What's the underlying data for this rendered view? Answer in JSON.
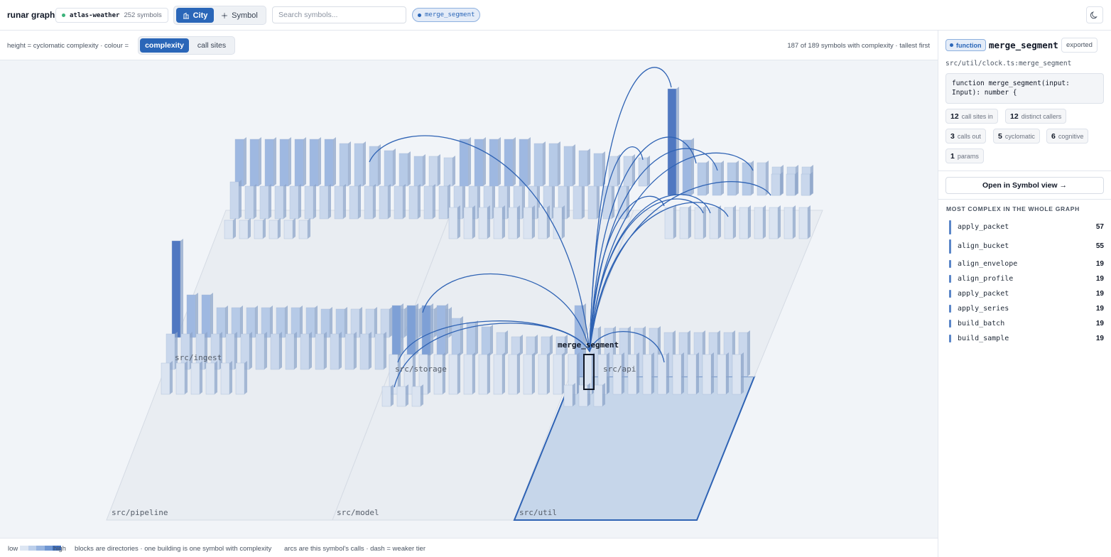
{
  "app": {
    "title": "runar graph"
  },
  "repo": {
    "name": "atlas-weather",
    "count": "252 symbols"
  },
  "view_toggle": {
    "city": "City",
    "symbol": "Symbol",
    "active": "City"
  },
  "search": {
    "placeholder": "Search symbols...",
    "value": ""
  },
  "selection_chip": {
    "label": "merge_segment"
  },
  "canvas_header": {
    "legend": "height = cyclomatic complexity · colour =",
    "modes": [
      "complexity",
      "call sites"
    ],
    "active_mode": "complexity",
    "status": "187 of 189 symbols with complexity · tallest first"
  },
  "city": {
    "directories": [
      "src/pipeline",
      "src/model",
      "src/util",
      "src/ingest",
      "src/storage",
      "src/api"
    ],
    "selected_directory": "src/util",
    "selected_symbol": "merge_segment"
  },
  "footer": {
    "low": "low",
    "high": "high",
    "text1": "blocks are directories · one building is one symbol with complexity",
    "text2": "arcs are this symbol's calls · dash = weaker tier",
    "swatches": [
      "#dde6f3",
      "#bccfeb",
      "#98b5e0",
      "#6f96d2",
      "#3f6fbf"
    ]
  },
  "panel": {
    "kind": "function",
    "name": "merge_segment",
    "exported": "exported",
    "path": "src/util/clock.ts:merge_segment",
    "signature": "function merge_segment(input:\nInput): number {",
    "stats": [
      {
        "value": "12",
        "label": "call sites in"
      },
      {
        "value": "12",
        "label": "distinct callers"
      },
      {
        "value": "3",
        "label": "calls out"
      },
      {
        "value": "5",
        "label": "cyclomatic"
      },
      {
        "value": "6",
        "label": "cognitive"
      },
      {
        "value": "1",
        "label": "params"
      }
    ],
    "open_button": "Open in Symbol view →",
    "most_complex_title": "MOST COMPLEX IN THE WHOLE GRAPH",
    "most_complex": [
      {
        "name": "apply_packet",
        "value": "57"
      },
      {
        "name": "align_bucket",
        "value": "55"
      },
      {
        "name": "align_envelope",
        "value": "19"
      },
      {
        "name": "align_profile",
        "value": "19"
      },
      {
        "name": "apply_packet",
        "value": "19"
      },
      {
        "name": "apply_series",
        "value": "19"
      },
      {
        "name": "build_batch",
        "value": "19"
      },
      {
        "name": "build_sample",
        "value": "19"
      }
    ]
  },
  "colors": {
    "accent": "#2a66b8",
    "selected_block": "#c6d6ea",
    "arc": "#2f63b4"
  }
}
